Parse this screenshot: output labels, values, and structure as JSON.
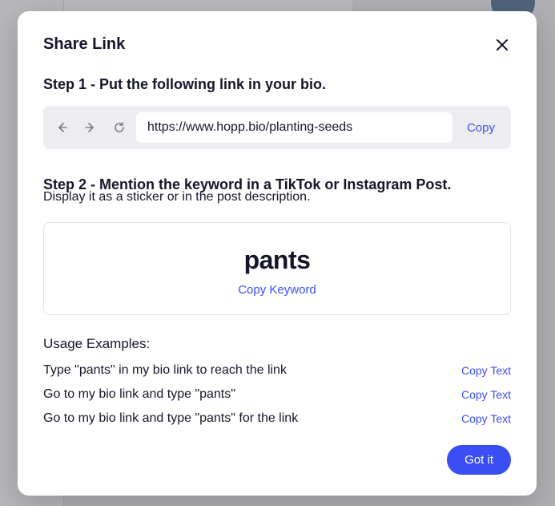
{
  "modal": {
    "title": "Share Link",
    "step1": {
      "heading": "Step 1 - Put the following link in your bio.",
      "url": "https://www.hopp.bio/planting-seeds",
      "copy_label": "Copy"
    },
    "step2": {
      "heading": "Step 2 - Mention the keyword in a TikTok or Instagram Post.",
      "subheading": "Display it as a sticker or in the post description.",
      "keyword": "pants",
      "copy_keyword_label": "Copy Keyword"
    },
    "usage": {
      "title": "Usage Examples:",
      "examples": [
        {
          "text": "Type \"pants\" in my bio link to reach the link",
          "copy_label": "Copy Text"
        },
        {
          "text": "Go to my bio link and type \"pants\"",
          "copy_label": "Copy Text"
        },
        {
          "text": "Go to my bio link and type \"pants\" for the link",
          "copy_label": "Copy Text"
        }
      ]
    },
    "footer": {
      "confirm_label": "Got it"
    }
  }
}
